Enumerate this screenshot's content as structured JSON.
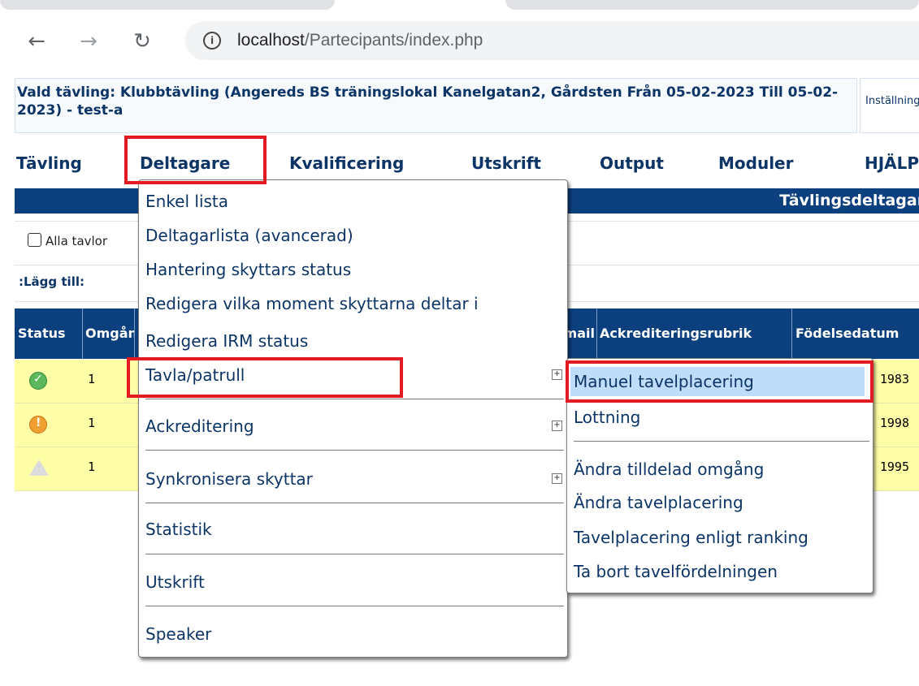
{
  "browser": {
    "back_icon": "arrow-left-icon",
    "forward_icon": "arrow-right-icon",
    "reload_icon": "reload-icon",
    "url_host": "localhost",
    "url_path": "/Partecipants/index.php"
  },
  "header": {
    "competition": "Vald tävling: Klubbtävling (Angereds BS träningslokal Kanelgatan2, Gårdsten Från 05-02-2023 Till 05-02-2023) - test-a",
    "settings_label": "Inställningar"
  },
  "menubar": {
    "items": [
      "Tävling",
      "Deltagare",
      "Kvalificering",
      "Utskrift",
      "Output",
      "Moduler",
      "HJÄLP"
    ]
  },
  "page": {
    "section_title": "Tävlingsdeltagare",
    "all_boards_label": "Alla tavlor",
    "add_label": ":Lägg till:"
  },
  "table": {
    "columns": [
      "Status",
      "Omgång",
      "E-mail",
      "Ackrediteringsrubrik",
      "Födelsedatum"
    ],
    "rows": [
      {
        "status": "ok",
        "omgang": "1",
        "date": "1983"
      },
      {
        "status": "warning",
        "omgang": "1",
        "date": "1998"
      },
      {
        "status": "alert",
        "omgang": "1",
        "date": "1995"
      }
    ]
  },
  "dropdown": {
    "items": [
      "Enkel lista",
      "Deltagarlista (avancerad)",
      "Hantering skyttars status",
      "Redigera vilka moment skyttarna deltar i",
      "Redigera IRM status",
      "Tavla/patrull",
      "Ackreditering",
      "Synkronisera skyttar",
      "Statistik",
      "Utskrift",
      "Speaker"
    ]
  },
  "submenu": {
    "items": [
      "Manuel tavelplacering",
      "Lottning",
      "Ändra tilldelad omgång",
      "Ändra tavelplacering",
      "Tavelplacering enligt ranking",
      "Ta bort tavelfördelningen"
    ]
  },
  "colors": {
    "highlight_box": "#e21b23",
    "header_blue": "#0c3f7e",
    "row_yellow": "#ffffa8",
    "submenu_selected": "#bfdcfa"
  }
}
